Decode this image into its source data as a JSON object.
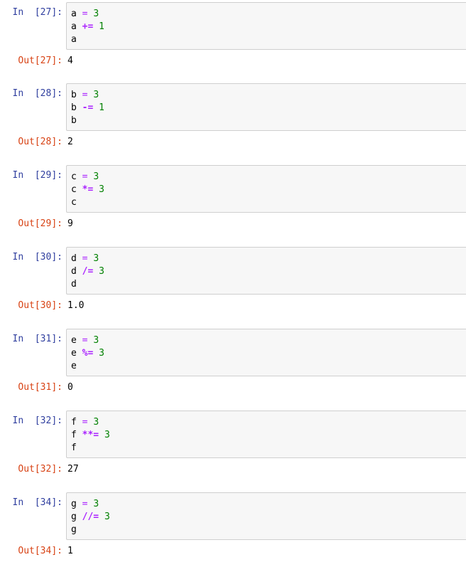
{
  "cells": [
    {
      "in_prompt": "In  [27]:",
      "var": "a",
      "eq": "=",
      "init": "3",
      "op": "+=",
      "operand": "1",
      "out_prompt": "Out[27]:",
      "out": "4"
    },
    {
      "in_prompt": "In  [28]:",
      "var": "b",
      "eq": "=",
      "init": "3",
      "op": "-=",
      "operand": "1",
      "out_prompt": "Out[28]:",
      "out": "2"
    },
    {
      "in_prompt": "In  [29]:",
      "var": "c",
      "eq": "=",
      "init": "3",
      "op": "*=",
      "operand": "3",
      "out_prompt": "Out[29]:",
      "out": "9"
    },
    {
      "in_prompt": "In  [30]:",
      "var": "d",
      "eq": "=",
      "init": "3",
      "op": "/=",
      "operand": "3",
      "out_prompt": "Out[30]:",
      "out": "1.0"
    },
    {
      "in_prompt": "In  [31]:",
      "var": "e",
      "eq": "=",
      "init": "3",
      "op": "%=",
      "operand": "3",
      "out_prompt": "Out[31]:",
      "out": "0"
    },
    {
      "in_prompt": "In  [32]:",
      "var": "f",
      "eq": "=",
      "init": "3",
      "op": "**=",
      "operand": "3",
      "out_prompt": "Out[32]:",
      "out": "27"
    },
    {
      "in_prompt": "In  [34]:",
      "var": "g",
      "eq": "=",
      "init": "3",
      "op": "//=",
      "operand": "3",
      "out_prompt": "Out[34]:",
      "out": "1"
    }
  ],
  "colors": {
    "in_prompt": "#303f9f",
    "out_prompt": "#d84315",
    "operator": "#aa22ff",
    "number": "#008000",
    "cell_background": "#f7f7f7",
    "cell_border": "#cfcfcf"
  }
}
